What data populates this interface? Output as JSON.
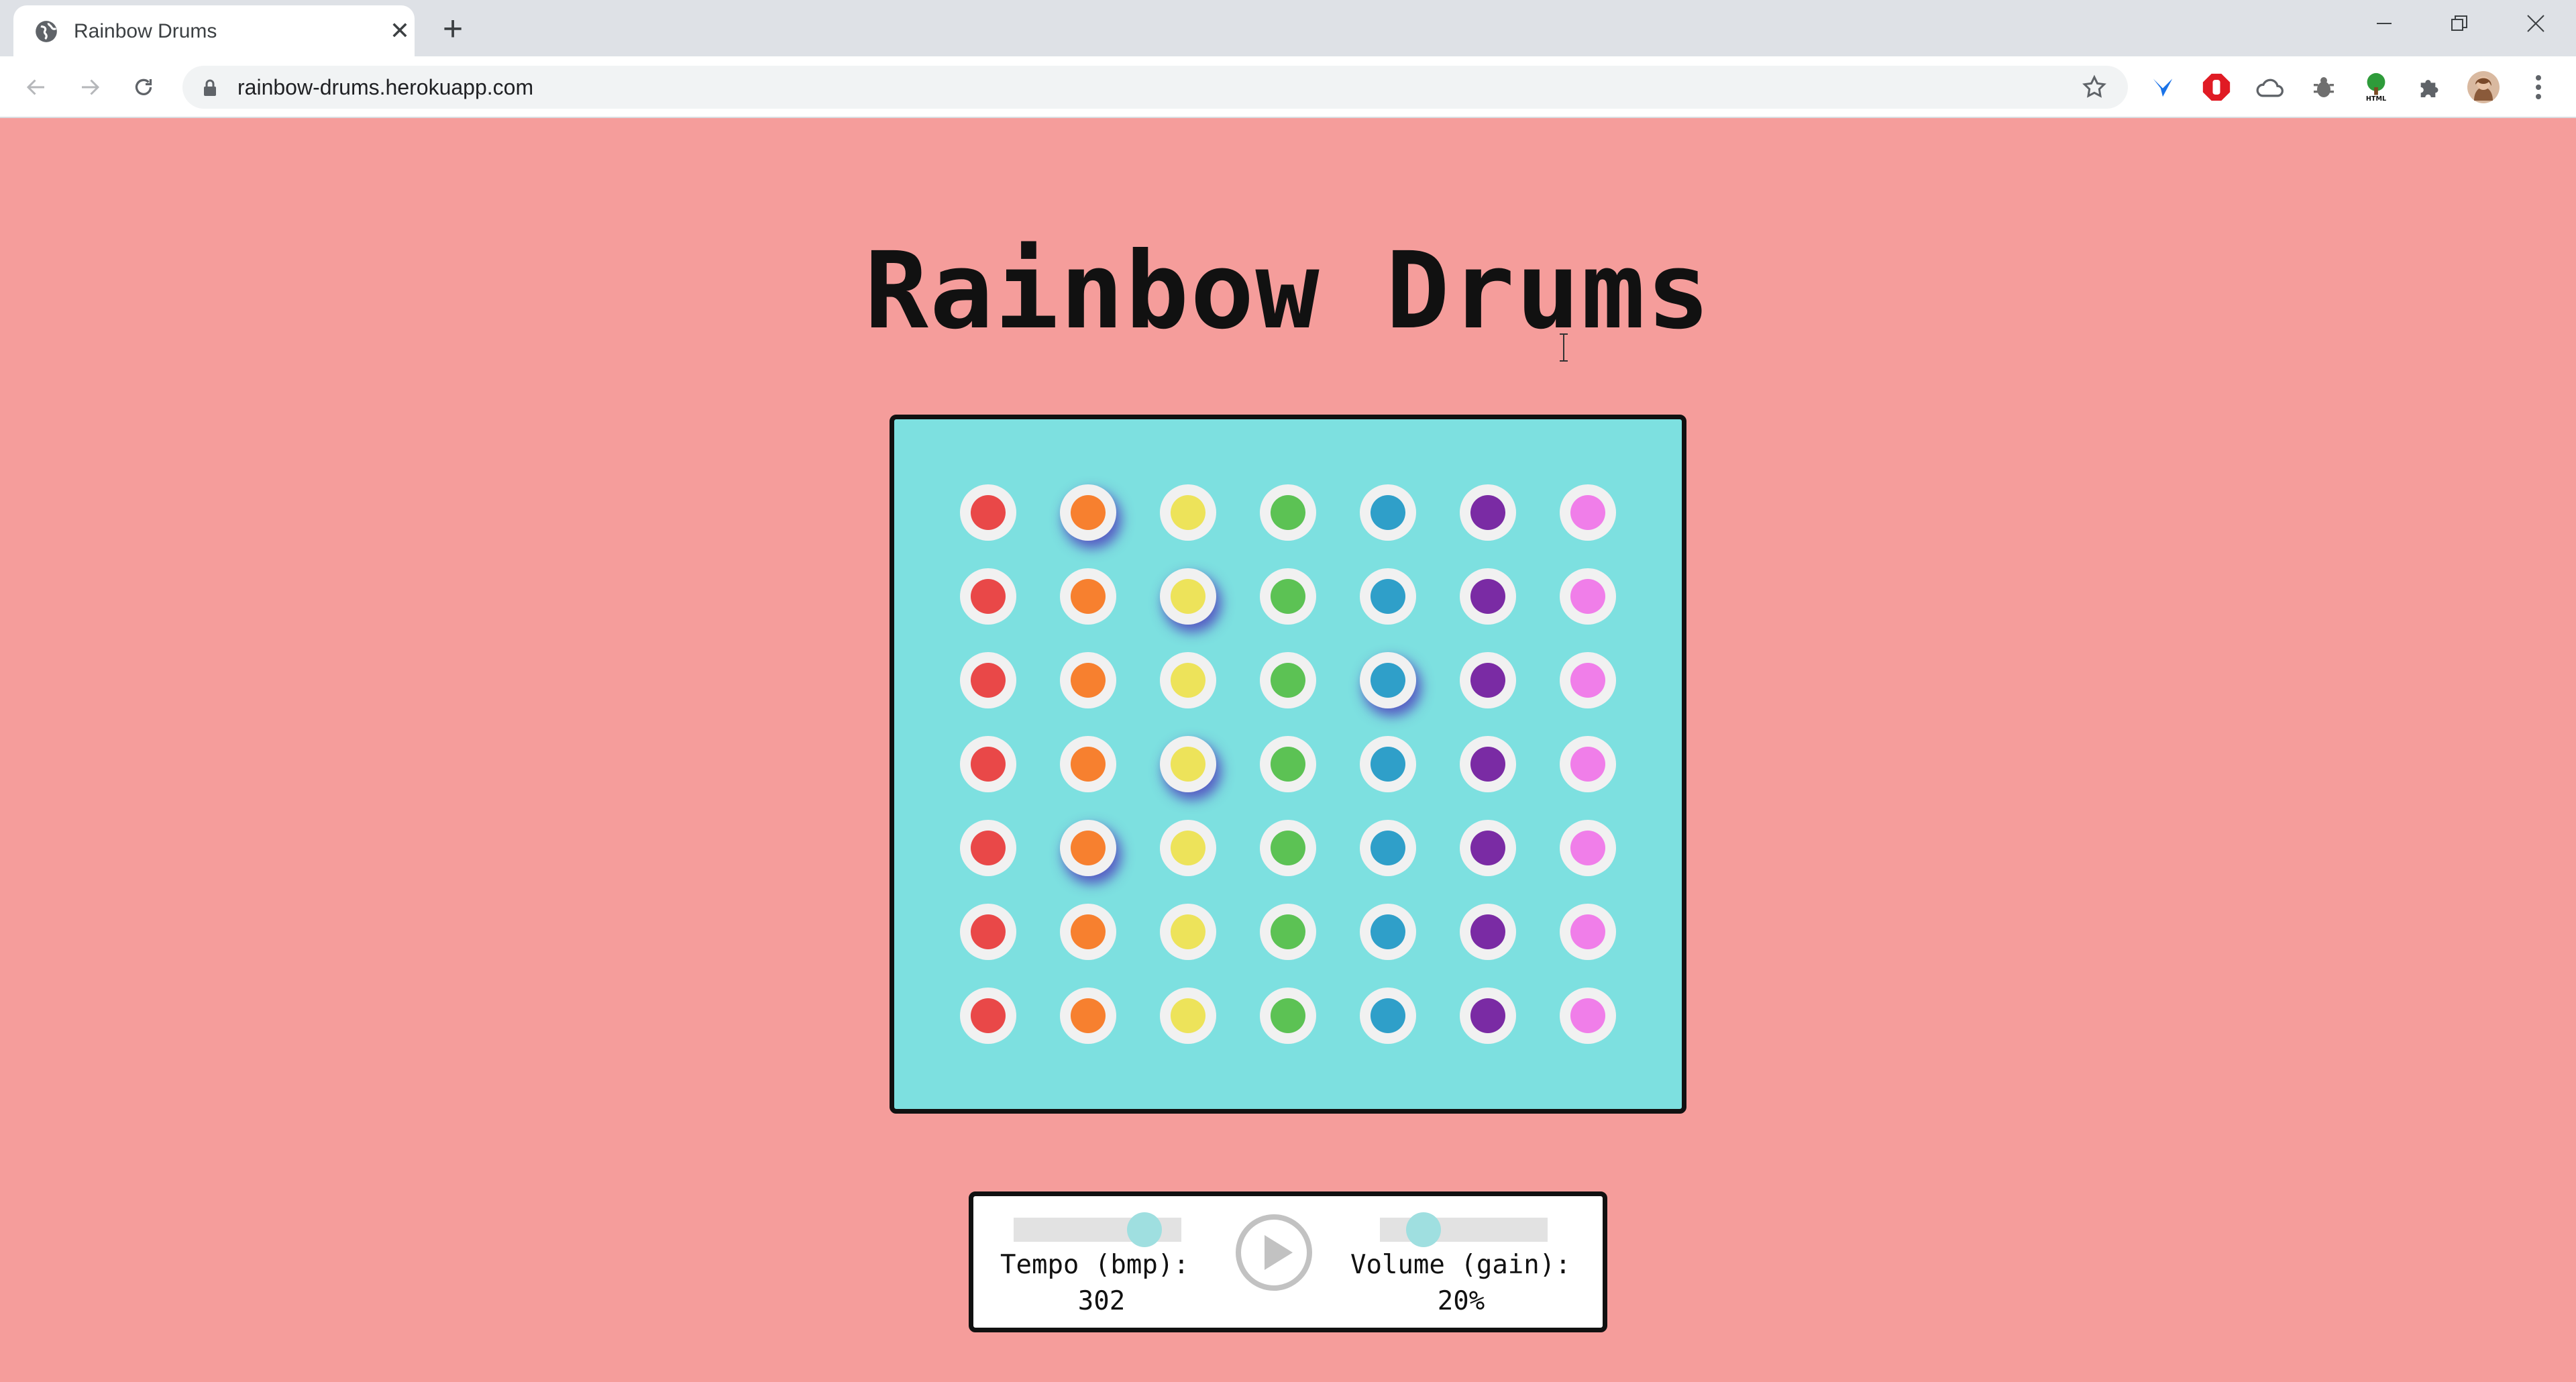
{
  "browser": {
    "tab_title": "Rainbow Drums",
    "url": "rainbow-drums.herokuapp.com",
    "extensions": [
      "y-extension-icon",
      "stop-extension-icon",
      "cloud-extension-icon",
      "bug-extension-icon",
      "tree-html-extension-icon",
      "puzzle-extensions-icon",
      "profile-avatar",
      "menu-kebab-icon"
    ]
  },
  "page": {
    "title": "Rainbow Drums"
  },
  "board": {
    "columns": [
      "#e94848",
      "#f7802f",
      "#ede35a",
      "#5cc254",
      "#2f9fc9",
      "#7a2ba4",
      "#f07ee9"
    ],
    "rows": 7,
    "active": [
      [
        0,
        1
      ],
      [
        1,
        2
      ],
      [
        2,
        4
      ],
      [
        3,
        2
      ],
      [
        4,
        1
      ]
    ]
  },
  "controls": {
    "tempo_label": "Tempo (bmp):",
    "tempo_value": "302",
    "tempo_level": 0.78,
    "volume_label": "Volume (gain):",
    "volume_value": "20%",
    "volume_level": 0.26
  }
}
